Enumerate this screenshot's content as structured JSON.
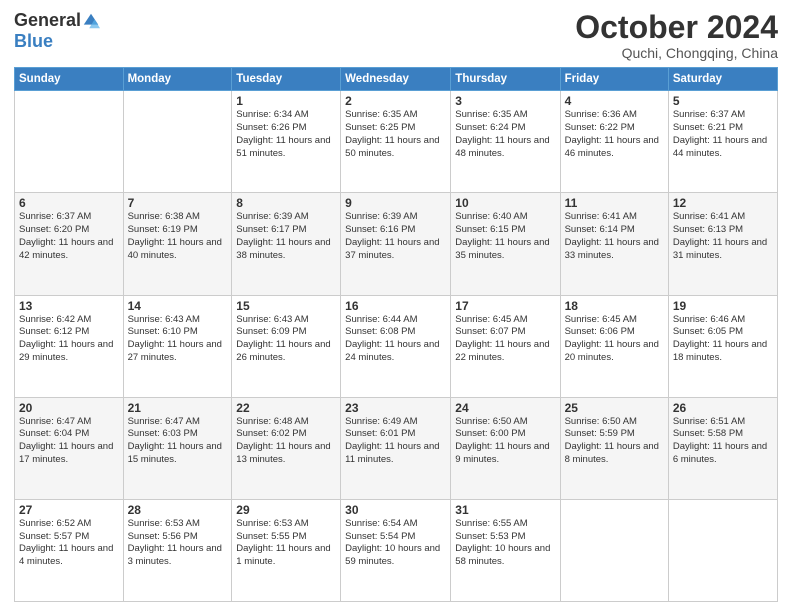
{
  "logo": {
    "general": "General",
    "blue": "Blue"
  },
  "title": "October 2024",
  "location": "Quchi, Chongqing, China",
  "days_of_week": [
    "Sunday",
    "Monday",
    "Tuesday",
    "Wednesday",
    "Thursday",
    "Friday",
    "Saturday"
  ],
  "weeks": [
    [
      {
        "day": "",
        "sunrise": "",
        "sunset": "",
        "daylight": ""
      },
      {
        "day": "",
        "sunrise": "",
        "sunset": "",
        "daylight": ""
      },
      {
        "day": "1",
        "sunrise": "Sunrise: 6:34 AM",
        "sunset": "Sunset: 6:26 PM",
        "daylight": "Daylight: 11 hours and 51 minutes."
      },
      {
        "day": "2",
        "sunrise": "Sunrise: 6:35 AM",
        "sunset": "Sunset: 6:25 PM",
        "daylight": "Daylight: 11 hours and 50 minutes."
      },
      {
        "day": "3",
        "sunrise": "Sunrise: 6:35 AM",
        "sunset": "Sunset: 6:24 PM",
        "daylight": "Daylight: 11 hours and 48 minutes."
      },
      {
        "day": "4",
        "sunrise": "Sunrise: 6:36 AM",
        "sunset": "Sunset: 6:22 PM",
        "daylight": "Daylight: 11 hours and 46 minutes."
      },
      {
        "day": "5",
        "sunrise": "Sunrise: 6:37 AM",
        "sunset": "Sunset: 6:21 PM",
        "daylight": "Daylight: 11 hours and 44 minutes."
      }
    ],
    [
      {
        "day": "6",
        "sunrise": "Sunrise: 6:37 AM",
        "sunset": "Sunset: 6:20 PM",
        "daylight": "Daylight: 11 hours and 42 minutes."
      },
      {
        "day": "7",
        "sunrise": "Sunrise: 6:38 AM",
        "sunset": "Sunset: 6:19 PM",
        "daylight": "Daylight: 11 hours and 40 minutes."
      },
      {
        "day": "8",
        "sunrise": "Sunrise: 6:39 AM",
        "sunset": "Sunset: 6:17 PM",
        "daylight": "Daylight: 11 hours and 38 minutes."
      },
      {
        "day": "9",
        "sunrise": "Sunrise: 6:39 AM",
        "sunset": "Sunset: 6:16 PM",
        "daylight": "Daylight: 11 hours and 37 minutes."
      },
      {
        "day": "10",
        "sunrise": "Sunrise: 6:40 AM",
        "sunset": "Sunset: 6:15 PM",
        "daylight": "Daylight: 11 hours and 35 minutes."
      },
      {
        "day": "11",
        "sunrise": "Sunrise: 6:41 AM",
        "sunset": "Sunset: 6:14 PM",
        "daylight": "Daylight: 11 hours and 33 minutes."
      },
      {
        "day": "12",
        "sunrise": "Sunrise: 6:41 AM",
        "sunset": "Sunset: 6:13 PM",
        "daylight": "Daylight: 11 hours and 31 minutes."
      }
    ],
    [
      {
        "day": "13",
        "sunrise": "Sunrise: 6:42 AM",
        "sunset": "Sunset: 6:12 PM",
        "daylight": "Daylight: 11 hours and 29 minutes."
      },
      {
        "day": "14",
        "sunrise": "Sunrise: 6:43 AM",
        "sunset": "Sunset: 6:10 PM",
        "daylight": "Daylight: 11 hours and 27 minutes."
      },
      {
        "day": "15",
        "sunrise": "Sunrise: 6:43 AM",
        "sunset": "Sunset: 6:09 PM",
        "daylight": "Daylight: 11 hours and 26 minutes."
      },
      {
        "day": "16",
        "sunrise": "Sunrise: 6:44 AM",
        "sunset": "Sunset: 6:08 PM",
        "daylight": "Daylight: 11 hours and 24 minutes."
      },
      {
        "day": "17",
        "sunrise": "Sunrise: 6:45 AM",
        "sunset": "Sunset: 6:07 PM",
        "daylight": "Daylight: 11 hours and 22 minutes."
      },
      {
        "day": "18",
        "sunrise": "Sunrise: 6:45 AM",
        "sunset": "Sunset: 6:06 PM",
        "daylight": "Daylight: 11 hours and 20 minutes."
      },
      {
        "day": "19",
        "sunrise": "Sunrise: 6:46 AM",
        "sunset": "Sunset: 6:05 PM",
        "daylight": "Daylight: 11 hours and 18 minutes."
      }
    ],
    [
      {
        "day": "20",
        "sunrise": "Sunrise: 6:47 AM",
        "sunset": "Sunset: 6:04 PM",
        "daylight": "Daylight: 11 hours and 17 minutes."
      },
      {
        "day": "21",
        "sunrise": "Sunrise: 6:47 AM",
        "sunset": "Sunset: 6:03 PM",
        "daylight": "Daylight: 11 hours and 15 minutes."
      },
      {
        "day": "22",
        "sunrise": "Sunrise: 6:48 AM",
        "sunset": "Sunset: 6:02 PM",
        "daylight": "Daylight: 11 hours and 13 minutes."
      },
      {
        "day": "23",
        "sunrise": "Sunrise: 6:49 AM",
        "sunset": "Sunset: 6:01 PM",
        "daylight": "Daylight: 11 hours and 11 minutes."
      },
      {
        "day": "24",
        "sunrise": "Sunrise: 6:50 AM",
        "sunset": "Sunset: 6:00 PM",
        "daylight": "Daylight: 11 hours and 9 minutes."
      },
      {
        "day": "25",
        "sunrise": "Sunrise: 6:50 AM",
        "sunset": "Sunset: 5:59 PM",
        "daylight": "Daylight: 11 hours and 8 minutes."
      },
      {
        "day": "26",
        "sunrise": "Sunrise: 6:51 AM",
        "sunset": "Sunset: 5:58 PM",
        "daylight": "Daylight: 11 hours and 6 minutes."
      }
    ],
    [
      {
        "day": "27",
        "sunrise": "Sunrise: 6:52 AM",
        "sunset": "Sunset: 5:57 PM",
        "daylight": "Daylight: 11 hours and 4 minutes."
      },
      {
        "day": "28",
        "sunrise": "Sunrise: 6:53 AM",
        "sunset": "Sunset: 5:56 PM",
        "daylight": "Daylight: 11 hours and 3 minutes."
      },
      {
        "day": "29",
        "sunrise": "Sunrise: 6:53 AM",
        "sunset": "Sunset: 5:55 PM",
        "daylight": "Daylight: 11 hours and 1 minute."
      },
      {
        "day": "30",
        "sunrise": "Sunrise: 6:54 AM",
        "sunset": "Sunset: 5:54 PM",
        "daylight": "Daylight: 10 hours and 59 minutes."
      },
      {
        "day": "31",
        "sunrise": "Sunrise: 6:55 AM",
        "sunset": "Sunset: 5:53 PM",
        "daylight": "Daylight: 10 hours and 58 minutes."
      },
      {
        "day": "",
        "sunrise": "",
        "sunset": "",
        "daylight": ""
      },
      {
        "day": "",
        "sunrise": "",
        "sunset": "",
        "daylight": ""
      }
    ]
  ]
}
